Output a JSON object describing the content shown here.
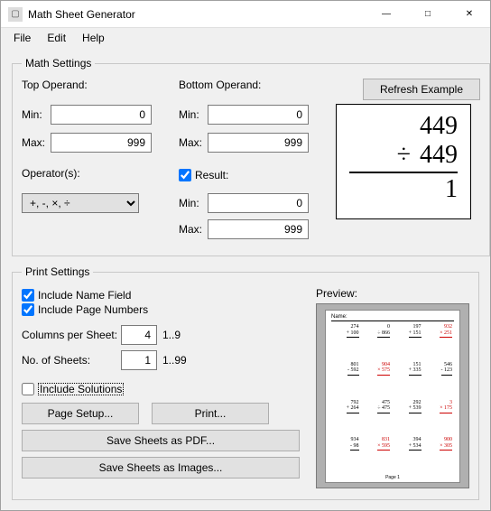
{
  "window": {
    "title": "Math Sheet Generator",
    "icon_glyph": "▢"
  },
  "menubar": {
    "items": [
      "File",
      "Edit",
      "Help"
    ]
  },
  "math_settings": {
    "legend": "Math Settings",
    "top_operand_label": "Top Operand:",
    "bottom_operand_label": "Bottom Operand:",
    "min_label": "Min:",
    "max_label": "Max:",
    "top_min": "0",
    "top_max": "999",
    "bottom_min": "0",
    "bottom_max": "999",
    "operators_label": "Operator(s):",
    "operators_value": "+, -, ×, ÷",
    "result_label": "Result:",
    "result_checked": true,
    "result_min": "0",
    "result_max": "999",
    "refresh_label": "Refresh Example",
    "example": {
      "top": "449",
      "op": "÷",
      "bottom": "449",
      "result": "1"
    }
  },
  "print_settings": {
    "legend": "Print Settings",
    "include_name_label": "Include Name Field",
    "include_name_checked": true,
    "include_page_label": "Include Page Numbers",
    "include_page_checked": true,
    "columns_label": "Columns per Sheet:",
    "columns_value": "4",
    "columns_hint": "1..9",
    "sheets_label": "No. of Sheets:",
    "sheets_value": "1",
    "sheets_hint": "1..99",
    "include_solutions_label": "Include Solutions",
    "include_solutions_checked": false,
    "page_setup_label": "Page Setup...",
    "print_label": "Print...",
    "save_pdf_label": "Save Sheets as PDF...",
    "save_images_label": "Save Sheets as Images...",
    "preview_label": "Preview:",
    "preview_name_label": "Name:",
    "preview_page_label": "Page 1",
    "preview_problems": [
      {
        "a": "274",
        "b": "+ 100",
        "red": false
      },
      {
        "a": "0",
        "b": "÷ 866",
        "red": false
      },
      {
        "a": "197",
        "b": "+ 151",
        "red": false
      },
      {
        "a": "932",
        "b": "× 251",
        "red": true
      },
      {
        "a": "801",
        "b": "- 592",
        "red": false
      },
      {
        "a": "904",
        "b": "× 575",
        "red": true
      },
      {
        "a": "151",
        "b": "+ 335",
        "red": false
      },
      {
        "a": "546",
        "b": "- 123",
        "red": false
      },
      {
        "a": "792",
        "b": "+ 264",
        "red": false
      },
      {
        "a": "475",
        "b": "÷ 475",
        "red": false
      },
      {
        "a": "292",
        "b": "+ 539",
        "red": false
      },
      {
        "a": "3",
        "b": "× 175",
        "red": true
      },
      {
        "a": "934",
        "b": "- 98",
        "red": false
      },
      {
        "a": "831",
        "b": "× 595",
        "red": true
      },
      {
        "a": "394",
        "b": "+ 534",
        "red": false
      },
      {
        "a": "900",
        "b": "× 305",
        "red": true
      }
    ]
  }
}
